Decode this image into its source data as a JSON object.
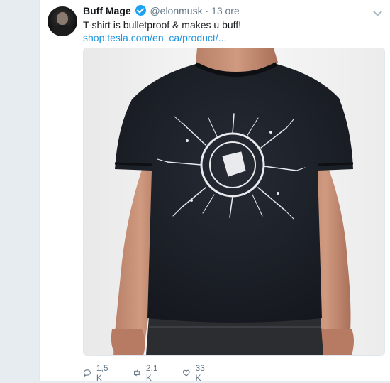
{
  "tweet": {
    "author_name": "Buff Mage",
    "author_handle": "@elonmusk",
    "time": "13 ore",
    "text": "T-shirt is bulletproof & makes u buff!",
    "link": "shop.tesla.com/en_ca/product/..."
  },
  "actions": {
    "replies": "1,5 K",
    "retweets": "2,1 K",
    "likes": "33 K"
  },
  "icons": {
    "reply": "reply-icon",
    "retweet": "retweet-icon",
    "like": "heart-icon",
    "verified": "verified-badge-icon",
    "menu": "chevron-down-icon"
  },
  "colors": {
    "link": "#1b95e0",
    "verified": "#1da1f2",
    "muted": "#657786",
    "text": "#14171a",
    "shirt": "#1d2129"
  }
}
